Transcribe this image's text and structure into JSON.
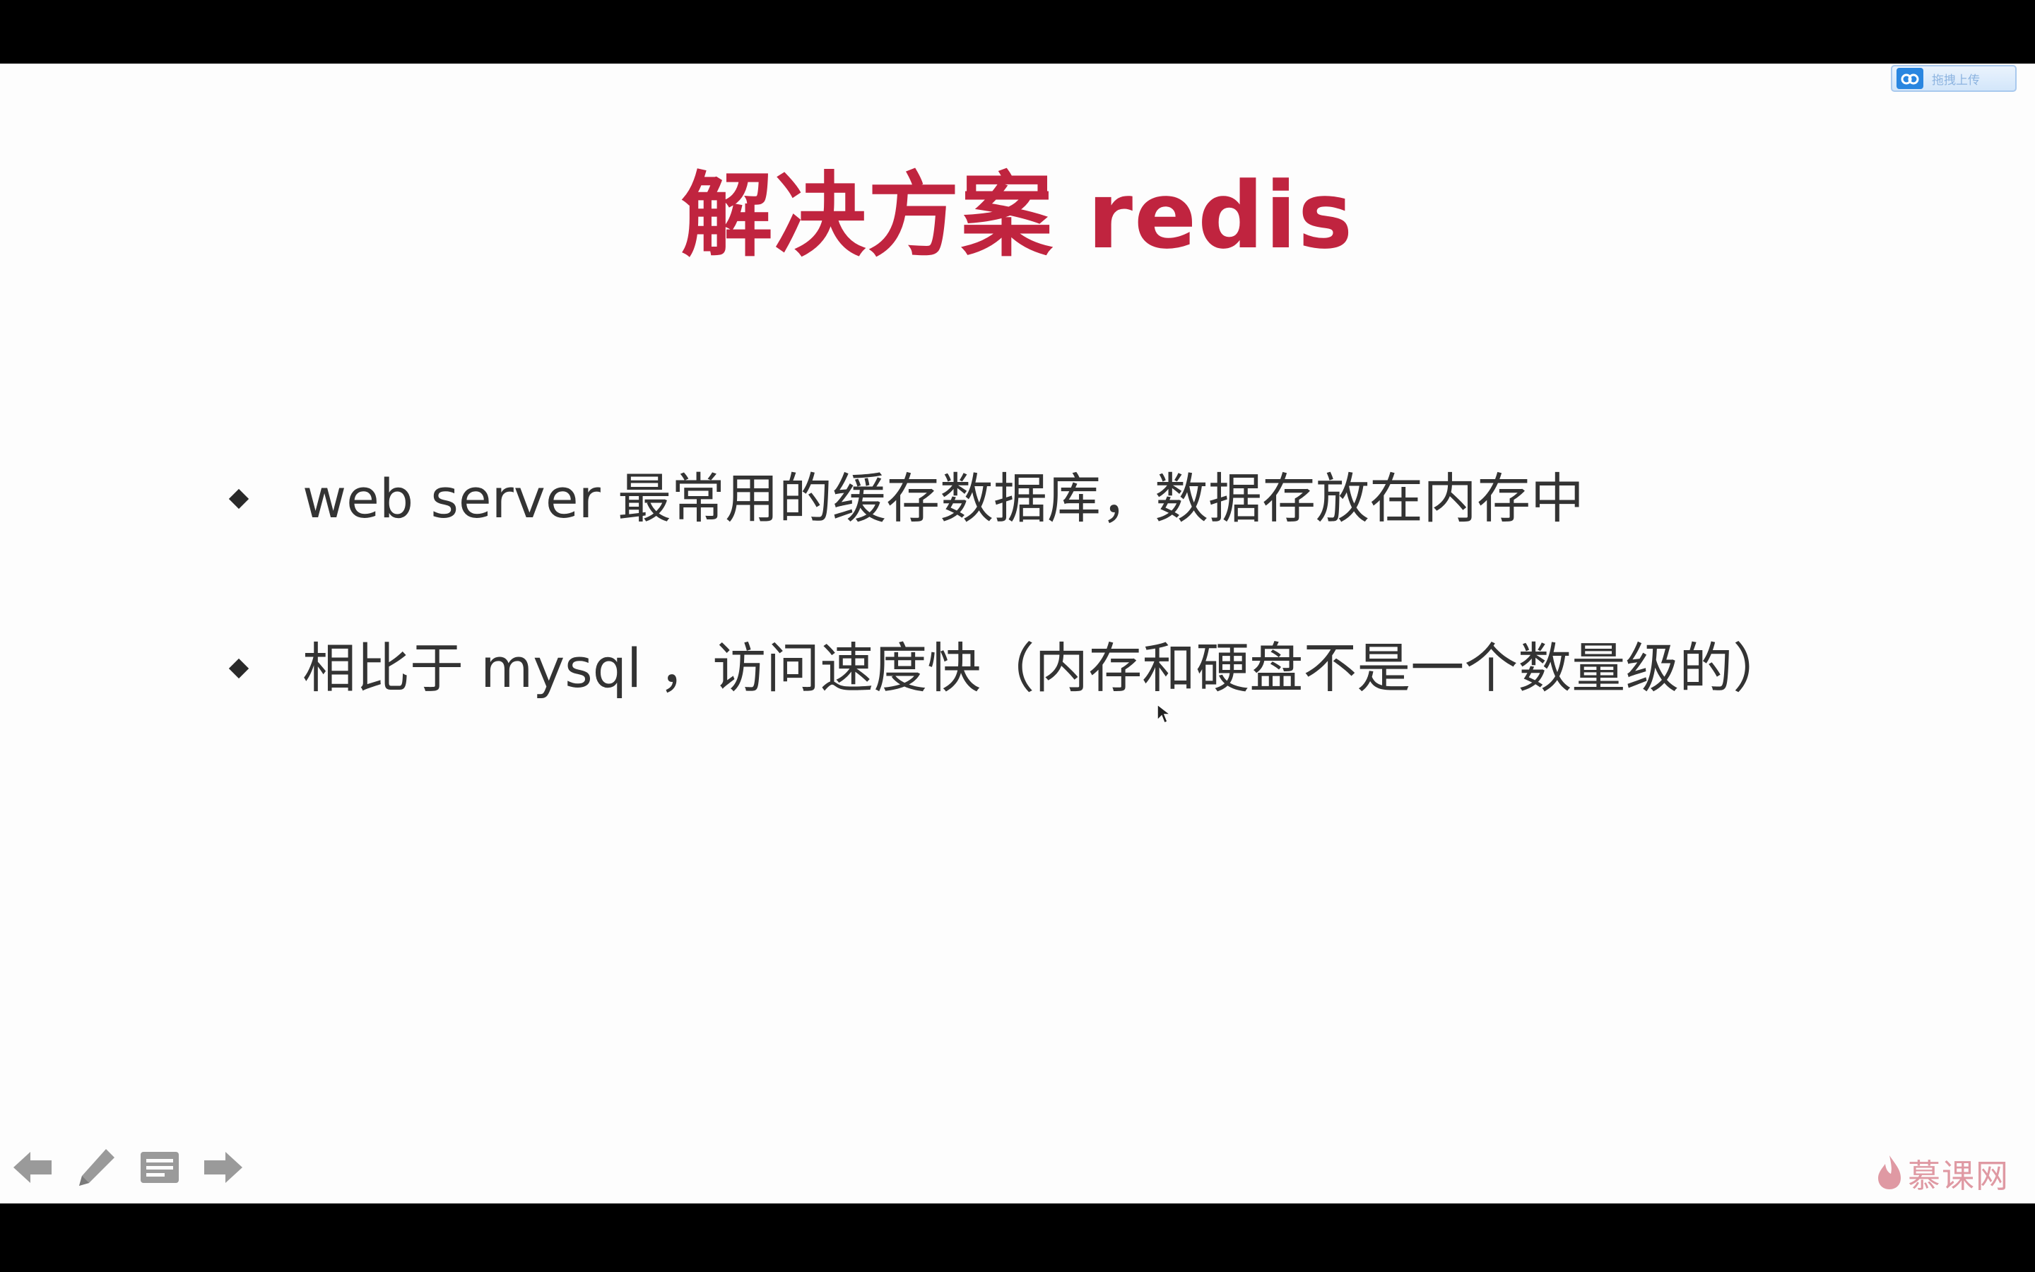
{
  "slide": {
    "title": "解决方案 redis",
    "bullets": [
      "web server 最常用的缓存数据库，数据存放在内存中",
      "相比于 mysql ，访问速度快（内存和硬盘不是一个数量级的）"
    ],
    "accent_color": "#c0243f",
    "text_color": "#333333"
  },
  "upload_badge": {
    "icon": "cloud-icon",
    "label": "拖拽上传"
  },
  "toolbar": {
    "icons": [
      "arrow-left-icon",
      "pencil-icon",
      "notes-icon",
      "arrow-right-icon"
    ]
  },
  "watermark": {
    "icon": "flame-icon",
    "text": "慕课网"
  }
}
